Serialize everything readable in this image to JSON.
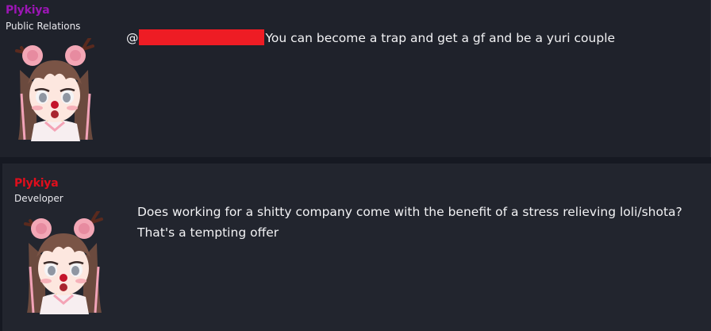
{
  "posts": [
    {
      "author": "Plykiya",
      "author_color": "#9c16b5",
      "role": "Public Relations",
      "mention_prefix": "@",
      "message": "You can become a trap and get a gf and be a yuri couple"
    },
    {
      "author": "Plykiya",
      "author_color": "#e00e1c",
      "role": "Developer",
      "message_lines": [
        "Does working for a shitty company come with the benefit of a stress relieving loli/shota?",
        "That's a tempting offer"
      ]
    }
  ],
  "colors": {
    "background": "#161922",
    "panel": "#1f222b",
    "redaction": "#ee1c24"
  },
  "icons": [
    "avatar-image"
  ]
}
